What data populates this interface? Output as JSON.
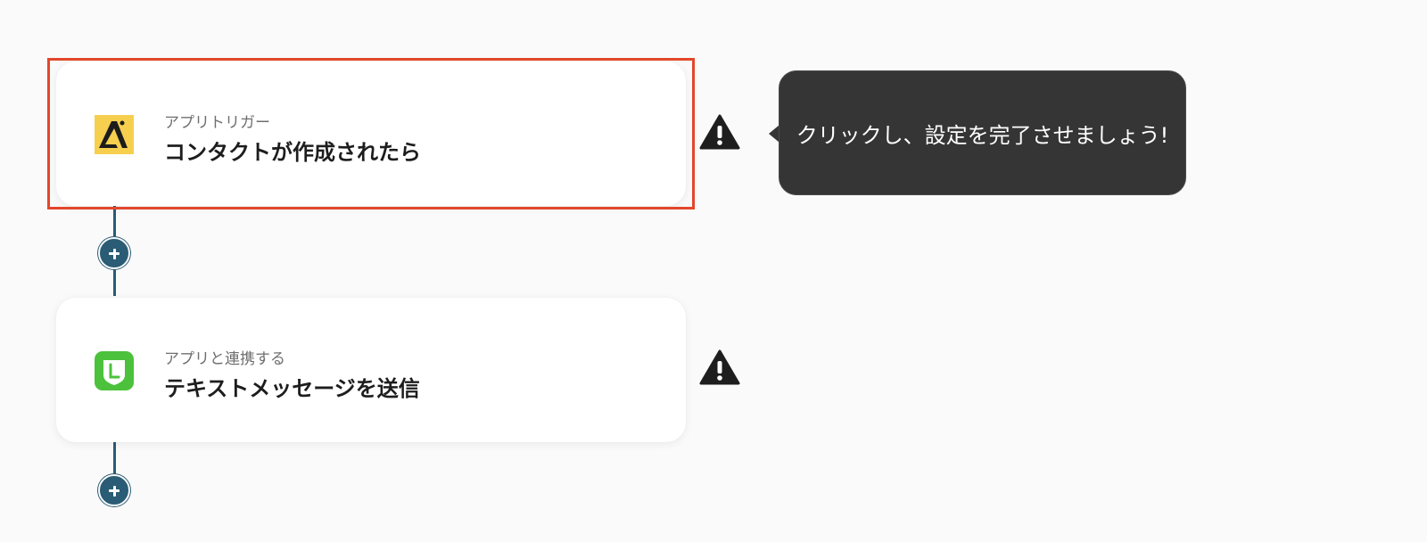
{
  "flow": {
    "steps": [
      {
        "label": "アプリトリガー",
        "title": "コンタクトが作成されたら",
        "app_icon": "yellow-app-logo-icon",
        "app_color": "#f6cf4f",
        "status_icon": "warning-icon"
      },
      {
        "label": "アプリと連携する",
        "title": "テキストメッセージを送信",
        "app_icon": "line-app-logo-icon",
        "app_color": "#4cc13c",
        "status_icon": "warning-icon"
      }
    ],
    "tooltip": {
      "text": "クリックし、設定を完了させましょう!"
    }
  },
  "colors": {
    "background": "#fafafa",
    "connector": "#2a5c75",
    "highlight": "#e2472b",
    "tooltip_bg": "#353535"
  }
}
